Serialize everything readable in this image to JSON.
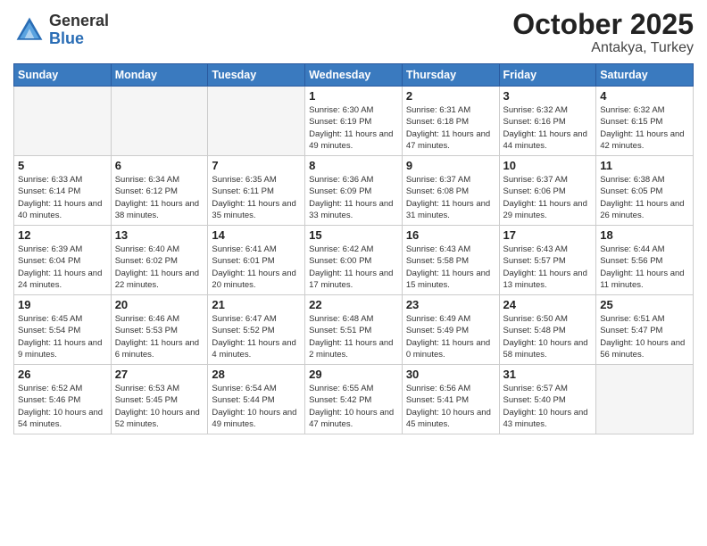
{
  "header": {
    "logo_line1": "General",
    "logo_line2": "Blue",
    "title": "October 2025",
    "subtitle": "Antakya, Turkey"
  },
  "weekdays": [
    "Sunday",
    "Monday",
    "Tuesday",
    "Wednesday",
    "Thursday",
    "Friday",
    "Saturday"
  ],
  "weeks": [
    [
      {
        "day": "",
        "info": ""
      },
      {
        "day": "",
        "info": ""
      },
      {
        "day": "",
        "info": ""
      },
      {
        "day": "1",
        "info": "Sunrise: 6:30 AM\nSunset: 6:19 PM\nDaylight: 11 hours\nand 49 minutes."
      },
      {
        "day": "2",
        "info": "Sunrise: 6:31 AM\nSunset: 6:18 PM\nDaylight: 11 hours\nand 47 minutes."
      },
      {
        "day": "3",
        "info": "Sunrise: 6:32 AM\nSunset: 6:16 PM\nDaylight: 11 hours\nand 44 minutes."
      },
      {
        "day": "4",
        "info": "Sunrise: 6:32 AM\nSunset: 6:15 PM\nDaylight: 11 hours\nand 42 minutes."
      }
    ],
    [
      {
        "day": "5",
        "info": "Sunrise: 6:33 AM\nSunset: 6:14 PM\nDaylight: 11 hours\nand 40 minutes."
      },
      {
        "day": "6",
        "info": "Sunrise: 6:34 AM\nSunset: 6:12 PM\nDaylight: 11 hours\nand 38 minutes."
      },
      {
        "day": "7",
        "info": "Sunrise: 6:35 AM\nSunset: 6:11 PM\nDaylight: 11 hours\nand 35 minutes."
      },
      {
        "day": "8",
        "info": "Sunrise: 6:36 AM\nSunset: 6:09 PM\nDaylight: 11 hours\nand 33 minutes."
      },
      {
        "day": "9",
        "info": "Sunrise: 6:37 AM\nSunset: 6:08 PM\nDaylight: 11 hours\nand 31 minutes."
      },
      {
        "day": "10",
        "info": "Sunrise: 6:37 AM\nSunset: 6:06 PM\nDaylight: 11 hours\nand 29 minutes."
      },
      {
        "day": "11",
        "info": "Sunrise: 6:38 AM\nSunset: 6:05 PM\nDaylight: 11 hours\nand 26 minutes."
      }
    ],
    [
      {
        "day": "12",
        "info": "Sunrise: 6:39 AM\nSunset: 6:04 PM\nDaylight: 11 hours\nand 24 minutes."
      },
      {
        "day": "13",
        "info": "Sunrise: 6:40 AM\nSunset: 6:02 PM\nDaylight: 11 hours\nand 22 minutes."
      },
      {
        "day": "14",
        "info": "Sunrise: 6:41 AM\nSunset: 6:01 PM\nDaylight: 11 hours\nand 20 minutes."
      },
      {
        "day": "15",
        "info": "Sunrise: 6:42 AM\nSunset: 6:00 PM\nDaylight: 11 hours\nand 17 minutes."
      },
      {
        "day": "16",
        "info": "Sunrise: 6:43 AM\nSunset: 5:58 PM\nDaylight: 11 hours\nand 15 minutes."
      },
      {
        "day": "17",
        "info": "Sunrise: 6:43 AM\nSunset: 5:57 PM\nDaylight: 11 hours\nand 13 minutes."
      },
      {
        "day": "18",
        "info": "Sunrise: 6:44 AM\nSunset: 5:56 PM\nDaylight: 11 hours\nand 11 minutes."
      }
    ],
    [
      {
        "day": "19",
        "info": "Sunrise: 6:45 AM\nSunset: 5:54 PM\nDaylight: 11 hours\nand 9 minutes."
      },
      {
        "day": "20",
        "info": "Sunrise: 6:46 AM\nSunset: 5:53 PM\nDaylight: 11 hours\nand 6 minutes."
      },
      {
        "day": "21",
        "info": "Sunrise: 6:47 AM\nSunset: 5:52 PM\nDaylight: 11 hours\nand 4 minutes."
      },
      {
        "day": "22",
        "info": "Sunrise: 6:48 AM\nSunset: 5:51 PM\nDaylight: 11 hours\nand 2 minutes."
      },
      {
        "day": "23",
        "info": "Sunrise: 6:49 AM\nSunset: 5:49 PM\nDaylight: 11 hours\nand 0 minutes."
      },
      {
        "day": "24",
        "info": "Sunrise: 6:50 AM\nSunset: 5:48 PM\nDaylight: 10 hours\nand 58 minutes."
      },
      {
        "day": "25",
        "info": "Sunrise: 6:51 AM\nSunset: 5:47 PM\nDaylight: 10 hours\nand 56 minutes."
      }
    ],
    [
      {
        "day": "26",
        "info": "Sunrise: 6:52 AM\nSunset: 5:46 PM\nDaylight: 10 hours\nand 54 minutes."
      },
      {
        "day": "27",
        "info": "Sunrise: 6:53 AM\nSunset: 5:45 PM\nDaylight: 10 hours\nand 52 minutes."
      },
      {
        "day": "28",
        "info": "Sunrise: 6:54 AM\nSunset: 5:44 PM\nDaylight: 10 hours\nand 49 minutes."
      },
      {
        "day": "29",
        "info": "Sunrise: 6:55 AM\nSunset: 5:42 PM\nDaylight: 10 hours\nand 47 minutes."
      },
      {
        "day": "30",
        "info": "Sunrise: 6:56 AM\nSunset: 5:41 PM\nDaylight: 10 hours\nand 45 minutes."
      },
      {
        "day": "31",
        "info": "Sunrise: 6:57 AM\nSunset: 5:40 PM\nDaylight: 10 hours\nand 43 minutes."
      },
      {
        "day": "",
        "info": ""
      }
    ]
  ]
}
